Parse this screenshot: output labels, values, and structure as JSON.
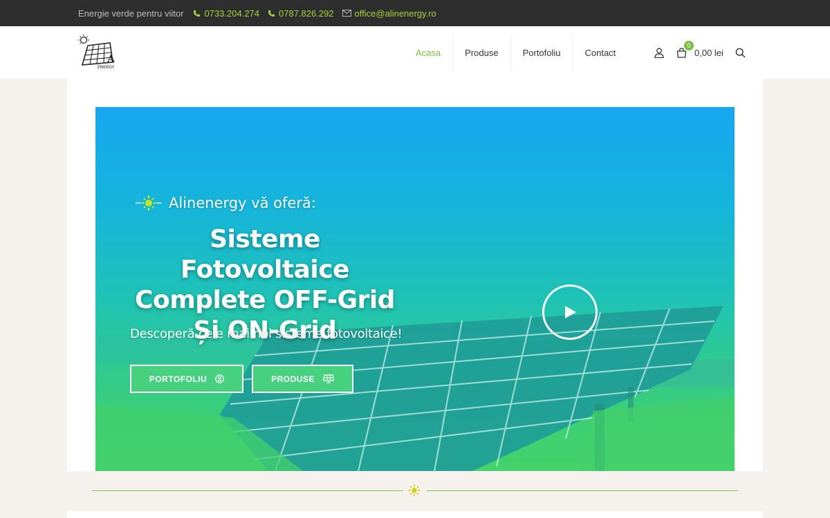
{
  "topbar": {
    "tagline": "Energie verde pentru viitor",
    "phone1": "0733.204.274",
    "phone2": "0787.826.292",
    "email": "office@alinenergy.ro"
  },
  "logo": {
    "text": "ENERGY"
  },
  "nav": {
    "items": [
      {
        "label": "Acasa",
        "active": true
      },
      {
        "label": "Produse",
        "active": false
      },
      {
        "label": "Portofoliu",
        "active": false
      },
      {
        "label": "Contact",
        "active": false
      }
    ]
  },
  "cart": {
    "count": "0",
    "total": "0,00 lei"
  },
  "hero": {
    "eyebrow": "Alinenergy vă oferă:",
    "headline_line1": "Sisteme Fotovoltaice",
    "headline_line2": "Complete OFF-Grid",
    "headline_line3": "Și ON-Grid",
    "subtitle": "Descoperă cele mai noi sisteme fotovoltaice!",
    "button1": "PORTOFOLIU",
    "button2": "PRODUSE"
  },
  "colors": {
    "accent": "#7ac143",
    "topbar_bg": "#2e2e2e",
    "link_green": "#a8d23a",
    "button_bg": "#47d17f",
    "sun": "#d4d11e"
  },
  "icons": {
    "phone": "phone-icon",
    "email": "envelope-icon",
    "user": "user-icon",
    "cart": "shopping-bag-icon",
    "search": "search-icon",
    "play": "play-icon",
    "sun": "sun-icon"
  }
}
